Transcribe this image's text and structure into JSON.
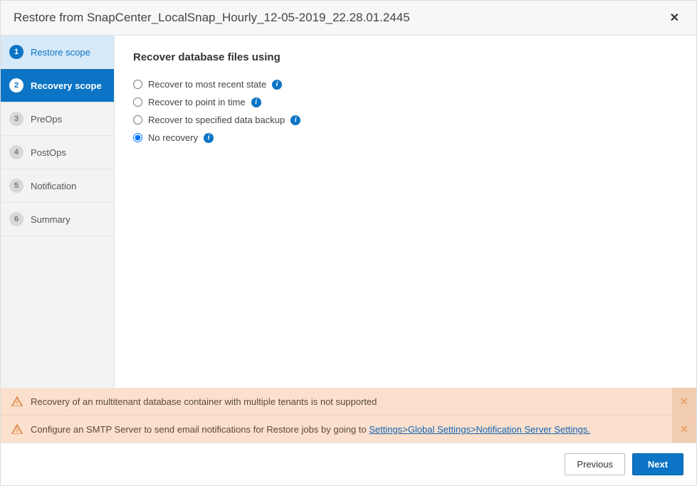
{
  "header": {
    "title": "Restore from SnapCenter_LocalSnap_Hourly_12-05-2019_22.28.01.2445"
  },
  "sidebar": {
    "steps": [
      {
        "num": "1",
        "label": "Restore scope",
        "state": "done"
      },
      {
        "num": "2",
        "label": "Recovery scope",
        "state": "active"
      },
      {
        "num": "3",
        "label": "PreOps",
        "state": "pending"
      },
      {
        "num": "4",
        "label": "PostOps",
        "state": "pending"
      },
      {
        "num": "5",
        "label": "Notification",
        "state": "pending"
      },
      {
        "num": "6",
        "label": "Summary",
        "state": "pending"
      }
    ]
  },
  "main": {
    "heading": "Recover database files using",
    "options": [
      {
        "label": "Recover to most recent state",
        "selected": false
      },
      {
        "label": "Recover to point in time",
        "selected": false
      },
      {
        "label": "Recover to specified data backup",
        "selected": false
      },
      {
        "label": "No recovery",
        "selected": true
      }
    ]
  },
  "alerts": [
    {
      "text": "Recovery of an multitenant database container with multiple tenants is not supported",
      "link": null
    },
    {
      "text": "Configure an SMTP Server to send email notifications for Restore jobs by going to ",
      "link": "Settings>Global Settings>Notification Server Settings."
    }
  ],
  "footer": {
    "previous": "Previous",
    "next": "Next"
  }
}
